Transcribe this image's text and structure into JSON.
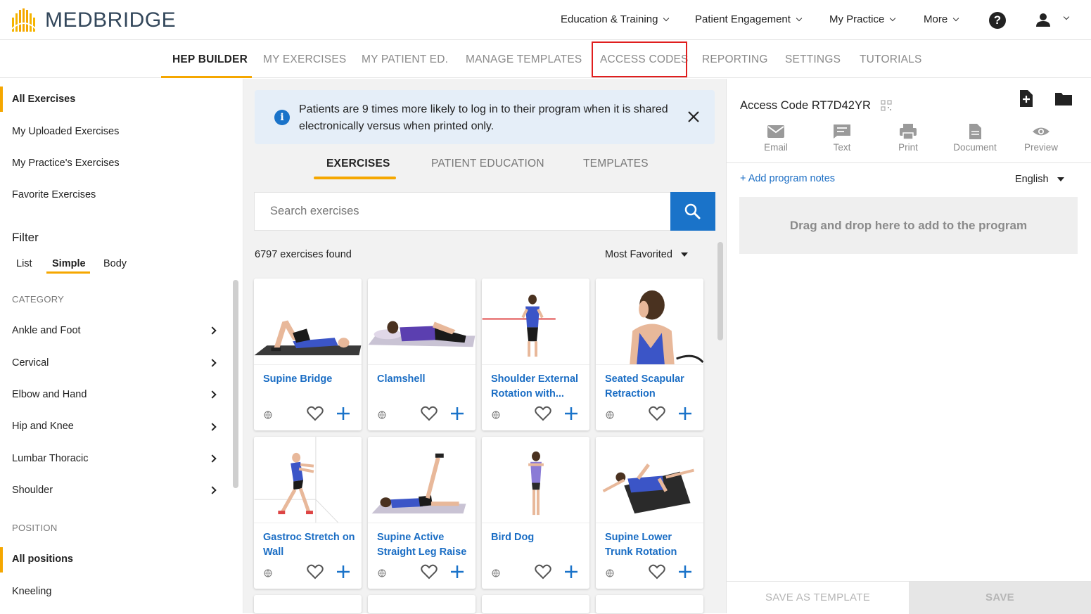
{
  "brand": {
    "name": "MEDBRIDGE"
  },
  "topnav": {
    "items": [
      {
        "label": "Education & Training"
      },
      {
        "label": "Patient Engagement"
      },
      {
        "label": "My Practice"
      },
      {
        "label": "More"
      }
    ]
  },
  "subnav": {
    "items": [
      {
        "label": "HEP BUILDER"
      },
      {
        "label": "MY EXERCISES"
      },
      {
        "label": "MY PATIENT ED."
      },
      {
        "label": "MANAGE TEMPLATES"
      },
      {
        "label": "ACCESS CODES"
      },
      {
        "label": "REPORTING"
      },
      {
        "label": "SETTINGS"
      },
      {
        "label": "TUTORIALS"
      }
    ]
  },
  "sidebar": {
    "lists": [
      {
        "label": "All Exercises"
      },
      {
        "label": "My Uploaded Exercises"
      },
      {
        "label": "My Practice's Exercises"
      },
      {
        "label": "Favorite Exercises"
      }
    ],
    "filter_title": "Filter",
    "filter_tabs": [
      {
        "label": "List"
      },
      {
        "label": "Simple"
      },
      {
        "label": "Body"
      }
    ],
    "category_heading": "CATEGORY",
    "categories": [
      {
        "label": "Ankle and Foot"
      },
      {
        "label": "Cervical"
      },
      {
        "label": "Elbow and Hand"
      },
      {
        "label": "Hip and Knee"
      },
      {
        "label": "Lumbar Thoracic"
      },
      {
        "label": "Shoulder"
      }
    ],
    "position_heading": "POSITION",
    "positions": [
      {
        "label": "All positions"
      },
      {
        "label": "Kneeling"
      }
    ]
  },
  "info": {
    "text": "Patients are 9 times more likely to log in to their program when it is shared electronically versus when printed only."
  },
  "center_tabs": [
    {
      "label": "EXERCISES"
    },
    {
      "label": "PATIENT EDUCATION"
    },
    {
      "label": "TEMPLATES"
    }
  ],
  "search": {
    "placeholder": "Search exercises"
  },
  "results": {
    "count_text": "6797 exercises found",
    "sort": "Most Favorited"
  },
  "exercises": [
    {
      "title": "Supine Bridge"
    },
    {
      "title": "Clamshell"
    },
    {
      "title": "Shoulder External Rotation with..."
    },
    {
      "title": "Seated Scapular Retraction"
    },
    {
      "title": "Gastroc Stretch on Wall"
    },
    {
      "title": "Supine Active Straight Leg Raise"
    },
    {
      "title": "Bird Dog"
    },
    {
      "title": "Supine Lower Trunk Rotation"
    }
  ],
  "program": {
    "access_label": "Access Code",
    "access_code": "RT7D42YR",
    "share": [
      {
        "label": "Email"
      },
      {
        "label": "Text"
      },
      {
        "label": "Print"
      },
      {
        "label": "Document"
      },
      {
        "label": "Preview"
      }
    ],
    "add_notes": "+ Add program notes",
    "language": "English",
    "dropzone": "Drag and drop here to add to the program",
    "save_template": "SAVE AS TEMPLATE",
    "save": "SAVE"
  },
  "colors": {
    "accent": "#f5a700",
    "primary": "#1a73c9",
    "link": "#1a6dc4",
    "highlight": "#e01e1e"
  }
}
